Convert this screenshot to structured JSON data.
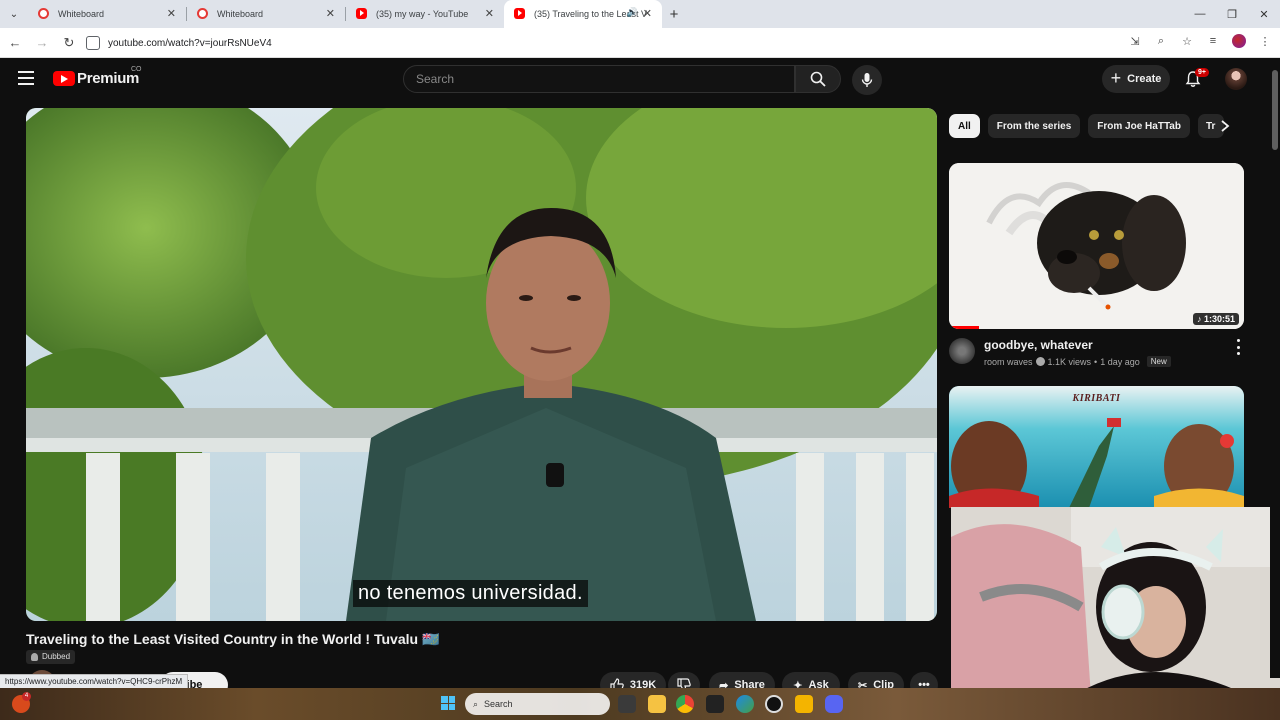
{
  "browser": {
    "tabs": [
      {
        "title": "Whiteboard",
        "type": "wb"
      },
      {
        "title": "Whiteboard",
        "type": "wb"
      },
      {
        "title": "(35) my way - YouTube",
        "type": "yt"
      },
      {
        "title": "(35) Traveling to the Least V",
        "type": "yt",
        "active": true
      }
    ],
    "url": "youtube.com/watch?v=jourRsNUeV4",
    "status_url": "https://www.youtube.com/watch?v=QHC9-crPhzM"
  },
  "header": {
    "logo_text": "Premium",
    "logo_superscript": "CO",
    "search_placeholder": "Search",
    "create_label": "Create",
    "notification_count": "9+"
  },
  "video": {
    "subtitle": "no tenemos universidad.",
    "title": "Traveling to the Least Visited Country in the World ! Tuvalu 🇹🇻",
    "dubbed_label": "Dubbed",
    "subscribe_label": "Subscribe",
    "subscribe_visible": "scribe",
    "likes": "319K",
    "share_label": "Share",
    "ask_label": "Ask",
    "clip_label": "Clip"
  },
  "sidebar": {
    "chips": [
      "All",
      "From the series",
      "From Joe HaTTab",
      "Tr"
    ],
    "recommendations": [
      {
        "title": "goodbye, whatever",
        "channel": "room waves",
        "views": "1.1K views",
        "age": "1 day ago",
        "badge": "New",
        "duration": "1:30:51"
      },
      {
        "thumb_label": "KIRIBATI"
      }
    ]
  },
  "taskbar": {
    "search_placeholder": "Search",
    "weather_badge": "4"
  },
  "colors": {
    "background": "#0f0f0f",
    "accent_red": "#ff0000",
    "chip_bg": "#272727"
  }
}
